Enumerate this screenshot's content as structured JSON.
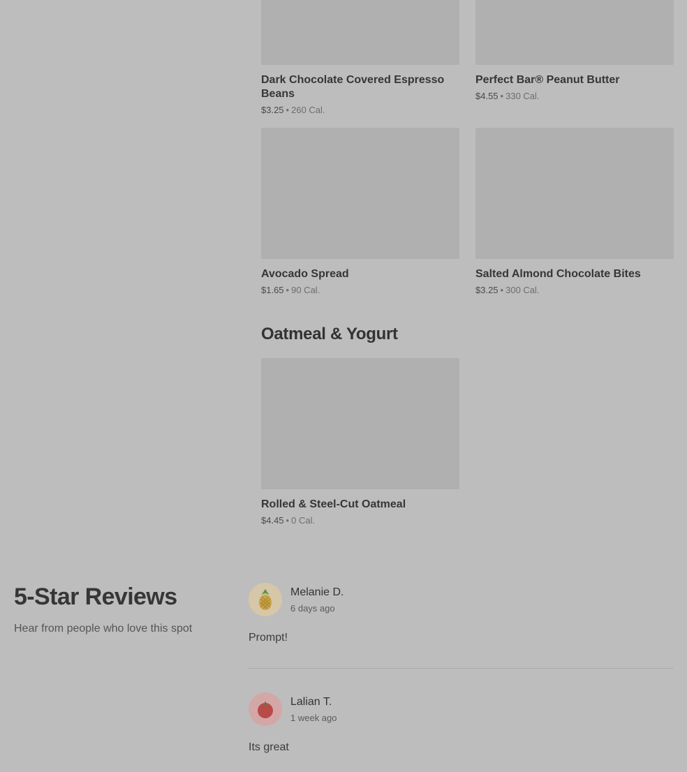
{
  "menu_items": [
    {
      "name": "Dark Chocolate Covered Espresso Beans",
      "price": "$3.25",
      "sep": "•",
      "calories": "260 Cal."
    },
    {
      "name": "Perfect Bar® Peanut Butter",
      "price": "$4.55",
      "sep": "•",
      "calories": "330 Cal."
    },
    {
      "name": "Avocado Spread",
      "price": "$1.65",
      "sep": "•",
      "calories": "90 Cal."
    },
    {
      "name": "Salted Almond Chocolate Bites",
      "price": "$3.25",
      "sep": "•",
      "calories": "300 Cal."
    }
  ],
  "oatmeal_section": {
    "title": "Oatmeal & Yogurt",
    "items": [
      {
        "name": "Rolled & Steel-Cut Oatmeal",
        "price": "$4.45",
        "sep": "•",
        "calories": "0 Cal."
      }
    ]
  },
  "reviews": {
    "title": "5-Star Reviews",
    "subtitle": "Hear from people who love this spot",
    "items": [
      {
        "name": "Melanie D.",
        "time": "6 days ago",
        "text": "Prompt!",
        "avatar_icon": "pineapple-icon",
        "avatar_bg": "#d6c7a8"
      },
      {
        "name": "Lalian T.",
        "time": "1 week ago",
        "text": "Its great",
        "avatar_icon": "tomato-icon",
        "avatar_bg": "#d4a7a7"
      }
    ]
  }
}
